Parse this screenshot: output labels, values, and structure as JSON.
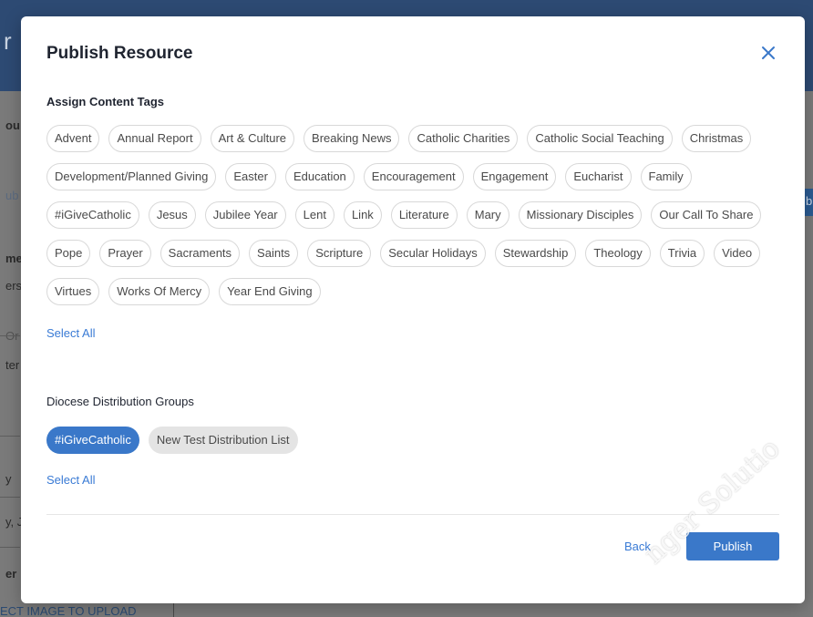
{
  "background": {
    "header_fragment": "r",
    "fragments": [
      {
        "id": "frag1",
        "text": "ou"
      },
      {
        "id": "frag2",
        "text": "ub"
      },
      {
        "id": "frag3",
        "text": "me"
      },
      {
        "id": "frag4",
        "text": "ers"
      },
      {
        "id": "frag5",
        "text": "Or"
      },
      {
        "id": "frag6",
        "text": "ter"
      },
      {
        "id": "frag7",
        "text": "y"
      },
      {
        "id": "frag8",
        "text": "y, J"
      },
      {
        "id": "frag9",
        "text": "er"
      },
      {
        "id": "frag10",
        "text": "ECT IMAGE TO UPLOAD"
      },
      {
        "id": "frag11",
        "text": "b"
      }
    ]
  },
  "modal": {
    "title": "Publish Resource",
    "close_icon": "close-icon",
    "content_tags_label": "Assign Content Tags",
    "content_tags": [
      "Advent",
      "Annual Report",
      "Art & Culture",
      "Breaking News",
      "Catholic Charities",
      "Catholic Social Teaching",
      "Christmas",
      "Development/Planned Giving",
      "Easter",
      "Education",
      "Encouragement",
      "Engagement",
      "Eucharist",
      "Family",
      "#iGiveCatholic",
      "Jesus",
      "Jubilee Year",
      "Lent",
      "Link",
      "Literature",
      "Mary",
      "Missionary Disciples",
      "Our Call To Share",
      "Pope",
      "Prayer",
      "Sacraments",
      "Saints",
      "Scripture",
      "Secular Holidays",
      "Stewardship",
      "Theology",
      "Trivia",
      "Video",
      "Virtues",
      "Works Of Mercy",
      "Year End Giving"
    ],
    "select_all_tags": "Select All",
    "groups_label": "Diocese Distribution Groups",
    "groups": [
      {
        "label": "#iGiveCatholic",
        "selected": true
      },
      {
        "label": "New Test Distribution List",
        "selected": false
      }
    ],
    "select_all_groups": "Select All",
    "back_label": "Back",
    "publish_label": "Publish"
  },
  "watermark": "nger Solutio",
  "colors": {
    "accent": "#3a78c9",
    "link": "#3a7bd5",
    "header_bg": "#2d4a73"
  }
}
